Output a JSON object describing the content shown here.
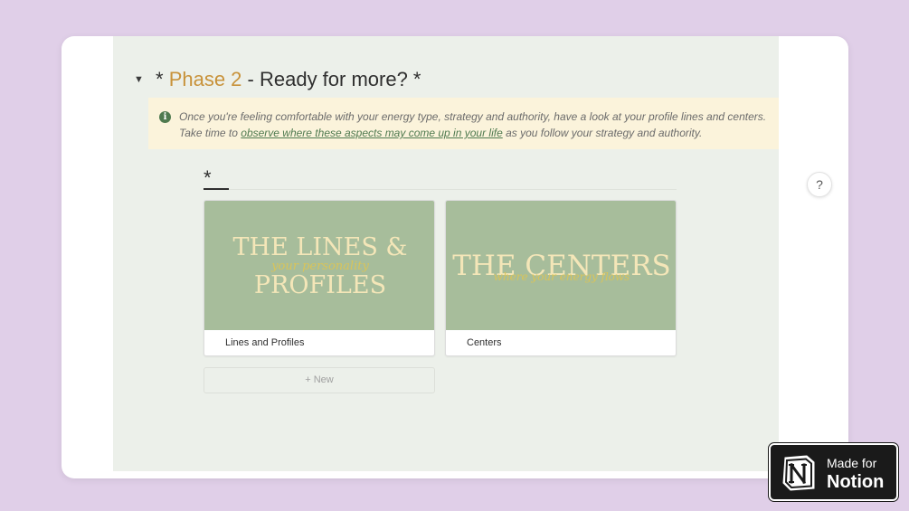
{
  "phase": {
    "toggle_glyph": "▼",
    "heading_prefix": "* ",
    "heading_accent": "Phase 2",
    "heading_rest": " - Ready for more? *",
    "accent_color": "#c8923a"
  },
  "callout": {
    "icon": "info-icon",
    "line1": "Once you're feeling comfortable with your energy type, strategy and authority, have a look at your profile lines and centers.",
    "line2_before": "Take time to ",
    "line2_link": "observe where these aspects may come up in your life",
    "line2_after": " as you follow your strategy and authority."
  },
  "database": {
    "title": "*",
    "cards": [
      {
        "cover_line1": "THE LINES &",
        "cover_script": "your personality",
        "cover_line2": "PROFILES",
        "label": "Lines and Profiles"
      },
      {
        "cover_line1": "THE CENTERS",
        "cover_script": "where your energy flows",
        "label": "Centers"
      }
    ],
    "new_label": "+ New"
  },
  "help": {
    "label": "?"
  },
  "badge": {
    "small": "Made for",
    "big": "Notion"
  },
  "colors": {
    "background": "#e0cfe8",
    "page": "#ecf0ea",
    "card_cover": "#a7bd9b",
    "cover_text": "#f4e6b8",
    "script_text": "#d9c45a"
  }
}
